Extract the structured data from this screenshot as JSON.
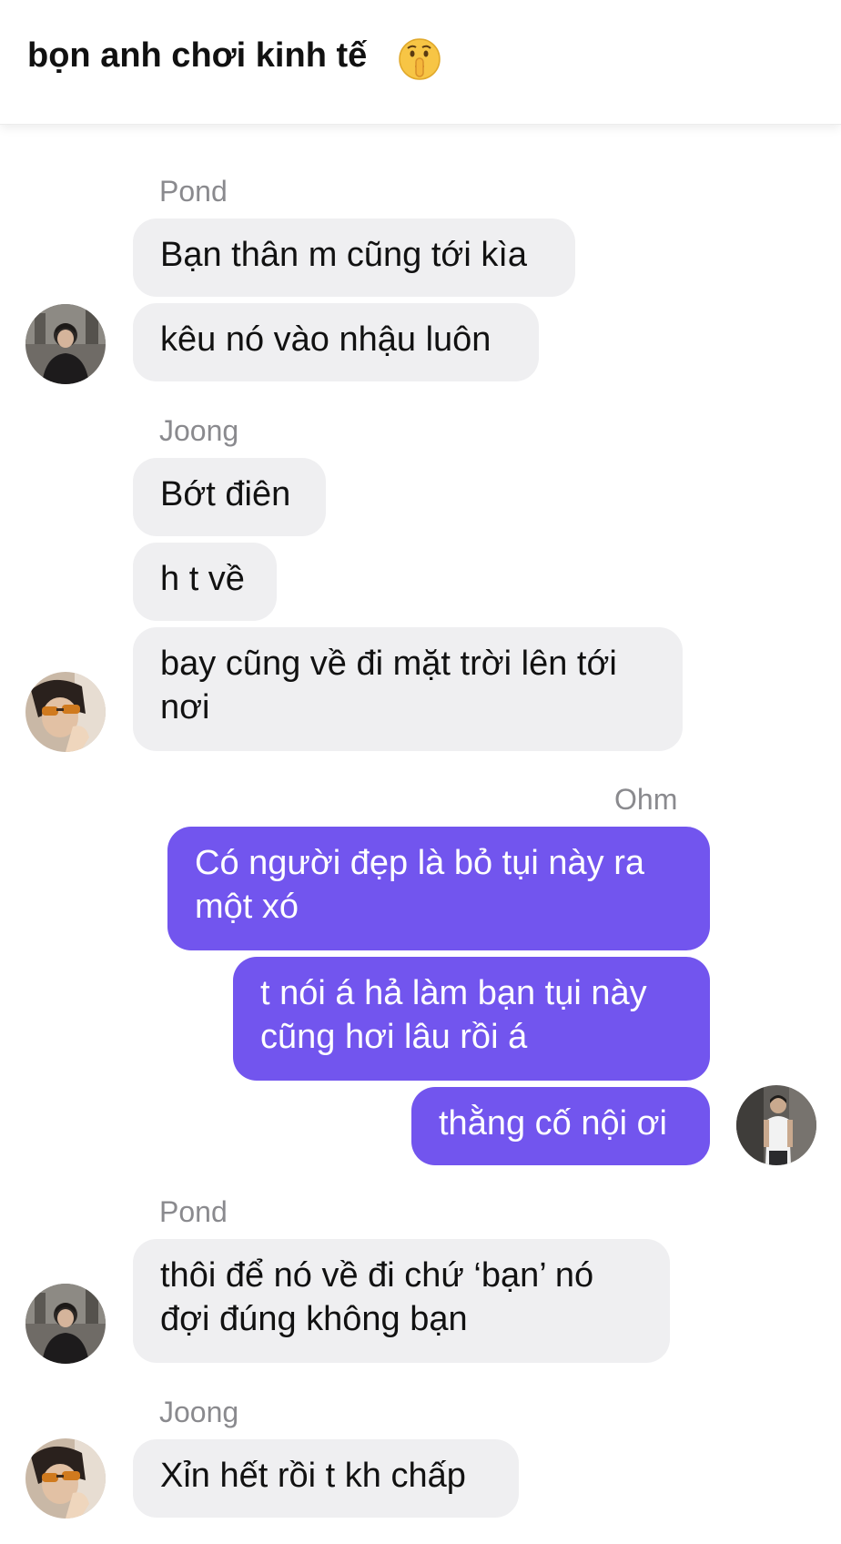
{
  "header": {
    "title": "bọn anh chơi kinh tế",
    "emoji": "shushing-face-icon"
  },
  "messages": [
    {
      "group": "pond",
      "sender": "Pond",
      "lines": [
        "Bạn thân m cũng tới kìa",
        "kêu nó vào nhậu luôn"
      ]
    },
    {
      "group": "joong",
      "sender": "Joong",
      "lines": [
        "Bớt điên",
        "h t về",
        "bay cũng về đi mặt trời lên tới nơi"
      ]
    },
    {
      "group": "ohm",
      "sender": "Ohm",
      "lines": [
        "Có người đẹp là bỏ tụi này ra một xó",
        "t nói á hả làm bạn tụi này cũng hơi lâu rồi á",
        "thằng cố nội ơi"
      ]
    },
    {
      "group": "pond",
      "sender": "Pond",
      "lines": [
        "thôi để nó về đi chứ ‘bạn’ nó đợi đúng không bạn"
      ]
    },
    {
      "group": "joong",
      "sender": "Joong",
      "lines": [
        "Xỉn hết rồi t kh chấp"
      ]
    }
  ],
  "colors": {
    "outgoing_bubble": "#7255ee",
    "incoming_bubble": "#efeff1",
    "sender_name": "#8a8a8e"
  }
}
